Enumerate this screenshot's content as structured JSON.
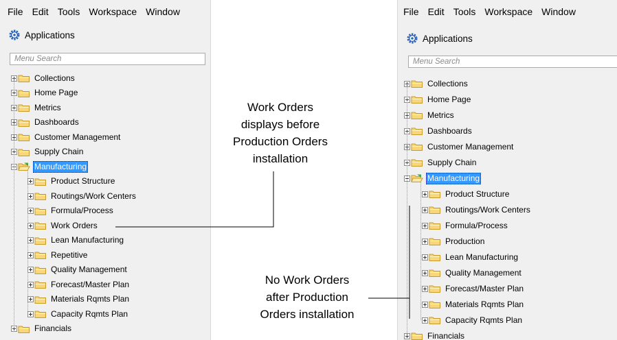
{
  "screens": [
    {
      "menubar": [
        "File",
        "Edit",
        "Tools",
        "Workspace",
        "Window"
      ],
      "header": "Applications",
      "search_placeholder": "Menu Search",
      "top_items": [
        "Collections",
        "Home Page",
        "Metrics",
        "Dashboards",
        "Customer Management",
        "Supply Chain"
      ],
      "selected_item": "Manufacturing",
      "children": [
        "Product Structure",
        "Routings/Work Centers",
        "Formula/Process",
        "Work Orders",
        "Lean Manufacturing",
        "Repetitive",
        "Quality Management",
        "Forecast/Master Plan",
        "Materials Rqmts Plan",
        "Capacity Rqmts Plan"
      ],
      "last_item": "Financials"
    },
    {
      "menubar": [
        "File",
        "Edit",
        "Tools",
        "Workspace",
        "Window"
      ],
      "header": "Applications",
      "search_placeholder": "Menu Search",
      "top_items": [
        "Collections",
        "Home Page",
        "Metrics",
        "Dashboards",
        "Customer Management",
        "Supply Chain"
      ],
      "selected_item": "Manufacturing",
      "children": [
        "Product Structure",
        "Routings/Work Centers",
        "Formula/Process",
        "Production",
        "Lean Manufacturing",
        "Quality Management",
        "Forecast/Master Plan",
        "Materials Rqmts Plan",
        "Capacity Rqmts Plan"
      ],
      "last_item": "Financials"
    }
  ],
  "callouts": {
    "before": [
      "Work Orders",
      "displays before",
      "Production Orders",
      "installation"
    ],
    "after": [
      "No Work Orders",
      "after Production",
      "Orders installation"
    ]
  },
  "colors": {
    "selection": "#3399ff",
    "folder_fill": "#f7d77a",
    "folder_stroke": "#c89a2a",
    "panel_bg": "#f0f0f0"
  },
  "icons": {
    "header": "gear-icon",
    "folder": "folder-icon",
    "open_folder": "folder-open-icon",
    "expander": "expander-icon"
  }
}
